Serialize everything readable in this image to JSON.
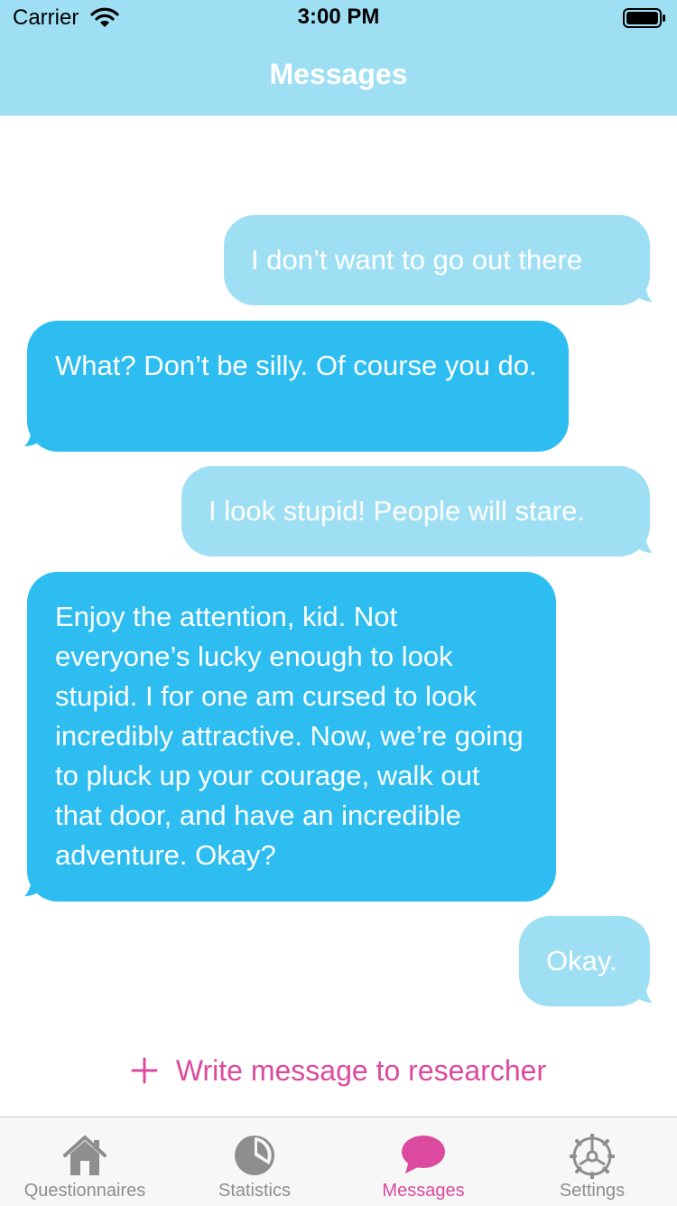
{
  "status_bar": {
    "carrier": "Carrier",
    "time": "3:00 PM"
  },
  "nav": {
    "title": "Messages"
  },
  "messages": [
    {
      "direction": "sent",
      "text": "I don’t want to go out there"
    },
    {
      "direction": "received",
      "text": "What? Don’t be silly. Of course you do."
    },
    {
      "direction": "sent",
      "text": "I look stupid! People will stare."
    },
    {
      "direction": "received",
      "text": "Enjoy the attention, kid. Not everyone’s lucky enough to look stupid. I for one am cursed to look incredibly attractive. Now, we’re going to pluck up your courage, walk out that door, and have an incredible adventure. Okay?"
    },
    {
      "direction": "sent",
      "text": "Okay."
    }
  ],
  "compose": {
    "label": "Write message to researcher",
    "icon": "plus-icon"
  },
  "tabs": [
    {
      "label": "Questionnaires",
      "icon": "house-icon",
      "active": false
    },
    {
      "label": "Statistics",
      "icon": "pie-chart-icon",
      "active": false
    },
    {
      "label": "Messages",
      "icon": "speech-bubble-icon",
      "active": true
    },
    {
      "label": "Settings",
      "icon": "gear-icon",
      "active": false
    }
  ],
  "colors": {
    "header": "#9fdff4",
    "sent_bubble": "#9fdff4",
    "received_bubble": "#2dbdf0",
    "accent": "#db4a9e",
    "tab_inactive": "#8e8e8e"
  }
}
